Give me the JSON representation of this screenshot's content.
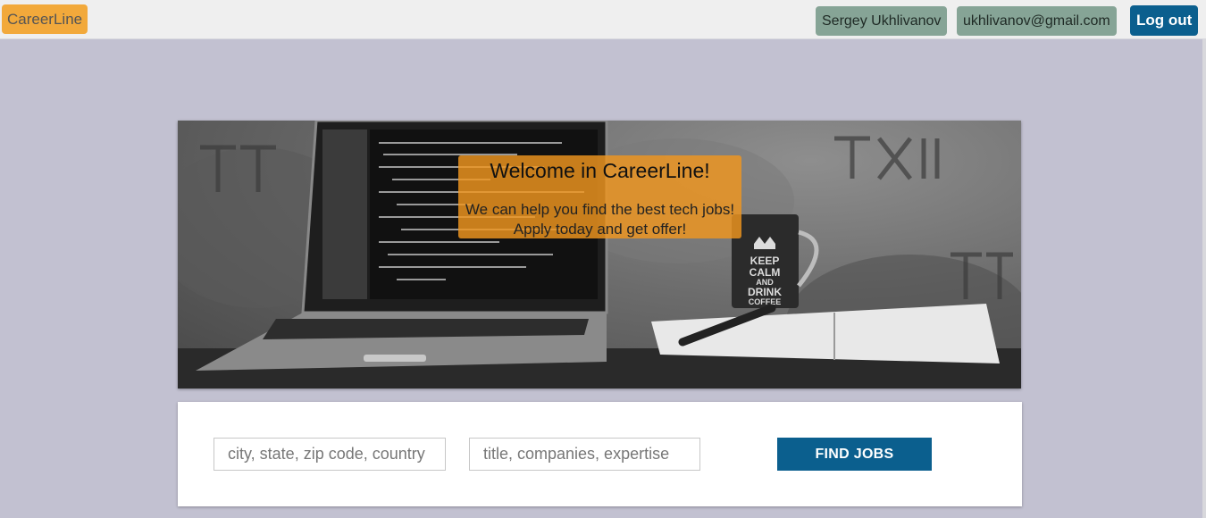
{
  "header": {
    "logo": "CareerLine",
    "user_name": "Sergey Ukhlivanov",
    "user_email": "ukhlivanov@gmail.com",
    "logout_label": "Log out"
  },
  "hero": {
    "title": "Welcome in CareerLine!",
    "subtitle_line1": "We can help you find the best tech jobs!",
    "subtitle_line2": "Apply today and get offer!",
    "mug_text": [
      "KEEP",
      "CALM",
      "AND",
      "DRINK",
      "COFFEE"
    ]
  },
  "search": {
    "location_placeholder": "city, state, zip code, country",
    "keyword_placeholder": "title, companies, expertise",
    "button_label": "FIND JOBS"
  },
  "colors": {
    "background": "#c2c1d1",
    "logo": "#f2a93b",
    "user_chip": "#86a496",
    "primary": "#0b5f8e"
  }
}
